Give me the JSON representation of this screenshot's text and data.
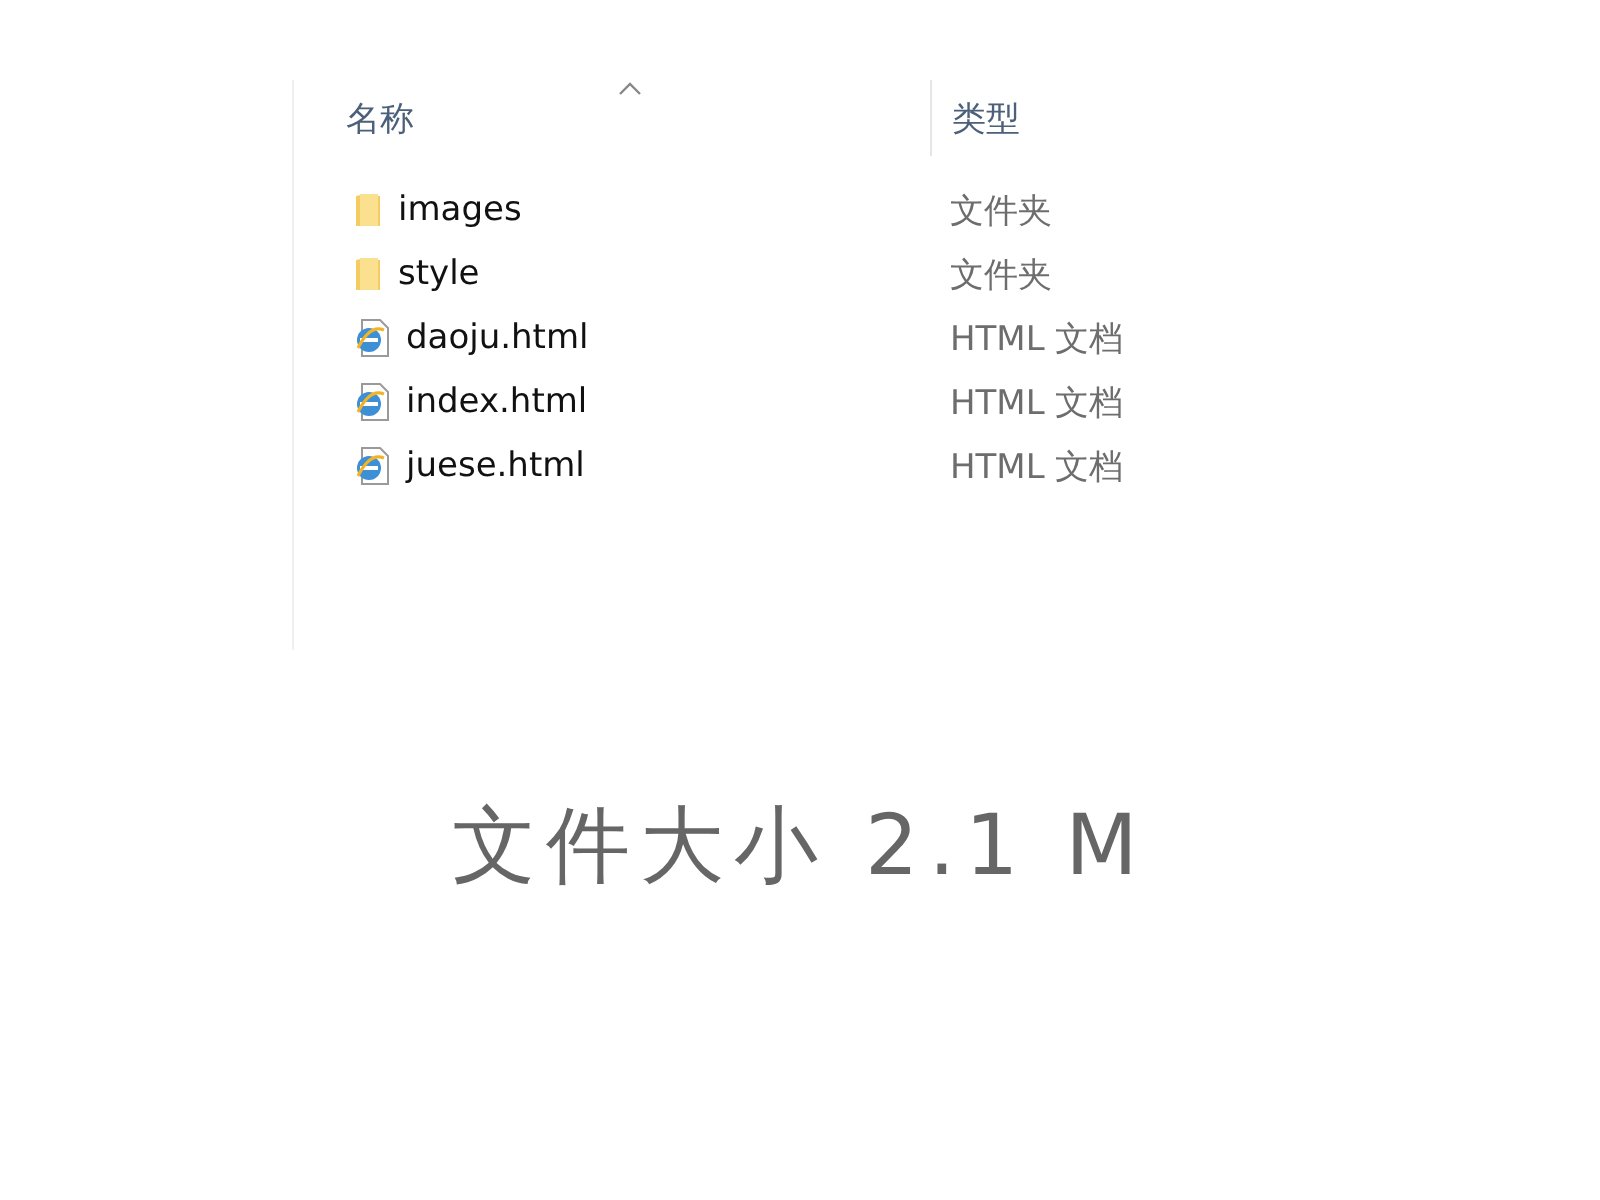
{
  "columns": [
    {
      "label": "名称",
      "sorted": true
    },
    {
      "label": "类型",
      "sorted": false
    }
  ],
  "files": [
    {
      "name": "images",
      "type": "文件夹",
      "kind": "folder"
    },
    {
      "name": "style",
      "type": "文件夹",
      "kind": "folder"
    },
    {
      "name": "daoju.html",
      "type": "HTML 文档",
      "kind": "html"
    },
    {
      "name": "index.html",
      "type": "HTML 文档",
      "kind": "html"
    },
    {
      "name": "juese.html",
      "type": "HTML 文档",
      "kind": "html"
    }
  ],
  "caption": "文件大小 2.1 M"
}
